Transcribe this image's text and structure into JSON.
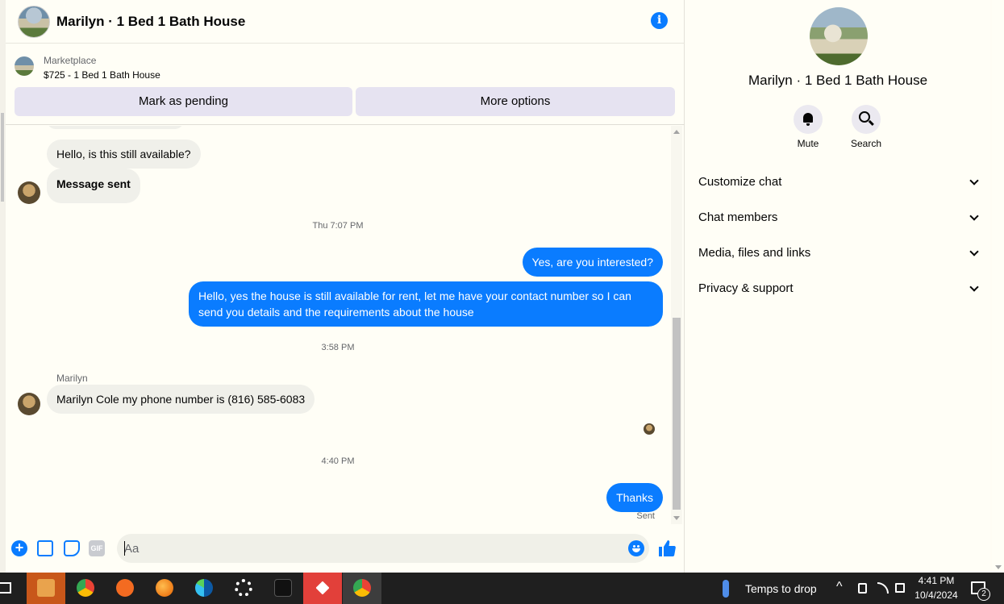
{
  "header": {
    "title": "Marilyn · 1 Bed 1 Bath House",
    "info_icon": "info-icon"
  },
  "marketplace": {
    "label": "Marketplace",
    "listing": "$725 - 1 Bed 1 Bath House",
    "pending_button": "Mark as pending",
    "more_button": "More options"
  },
  "messages": [
    {
      "side": "in",
      "text": "Hello, is this still available?"
    },
    {
      "side": "in",
      "text": "Message sent"
    },
    {
      "type": "timestamp",
      "text": "Thu 7:07 PM"
    },
    {
      "side": "out",
      "text": "Yes, are you interested?"
    },
    {
      "side": "out",
      "text": "Hello, yes the house is still available for rent, let me have your contact number so I can send you details and the requirements about the house"
    },
    {
      "type": "timestamp",
      "text": "3:58 PM"
    },
    {
      "side": "in",
      "sender": "Marilyn",
      "text": "Marilyn Cole my phone number is (816) 585-6083"
    },
    {
      "type": "timestamp",
      "text": "4:40 PM"
    },
    {
      "side": "out",
      "text": "Thanks",
      "status": "Sent"
    }
  ],
  "composer": {
    "placeholder": "Aa",
    "value": "",
    "gif_label": "GIF"
  },
  "right_panel": {
    "title": "Marilyn · 1 Bed 1 Bath House",
    "actions": [
      {
        "label": "Mute",
        "icon": "bell-icon"
      },
      {
        "label": "Search",
        "icon": "search-icon"
      }
    ],
    "sections": [
      {
        "label": "Customize chat"
      },
      {
        "label": "Chat members"
      },
      {
        "label": "Media, files and links"
      },
      {
        "label": "Privacy & support"
      }
    ]
  },
  "taskbar": {
    "weather": "Temps to drop",
    "time": "4:41 PM",
    "date": "10/4/2024",
    "notifications": "2"
  },
  "colors": {
    "accent": "#0a7cff",
    "bubble_in": "#f0f0ea",
    "button_bg": "#e6e3f1"
  }
}
